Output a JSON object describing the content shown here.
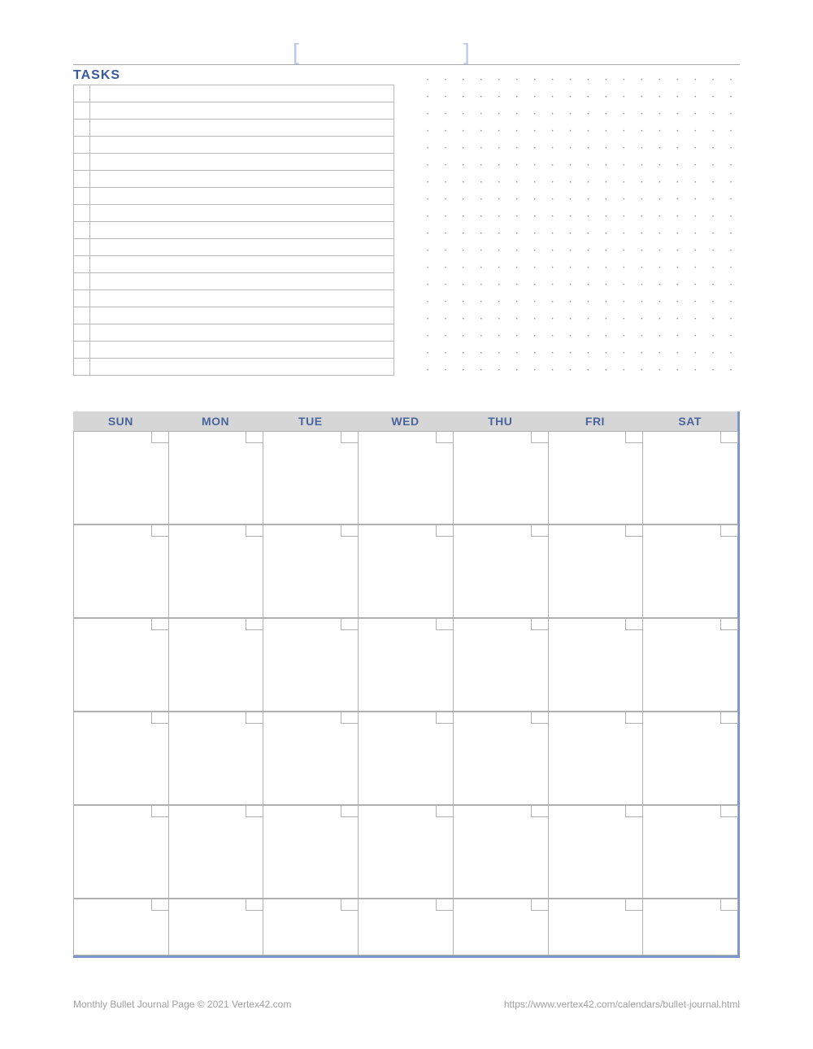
{
  "title_brackets": {
    "left": "[",
    "right": "]"
  },
  "tasks": {
    "heading": "TASKS",
    "row_count": 17
  },
  "dot_grid": {
    "rows": 18,
    "cols": 18
  },
  "calendar": {
    "days": [
      "SUN",
      "MON",
      "TUE",
      "WED",
      "THU",
      "FRI",
      "SAT"
    ],
    "full_rows": 5,
    "has_short_row": true
  },
  "footer": {
    "left": "Monthly Bullet Journal Page © 2021 Vertex42.com",
    "right": "https://www.vertex42.com/calendars/bullet-journal.html"
  }
}
